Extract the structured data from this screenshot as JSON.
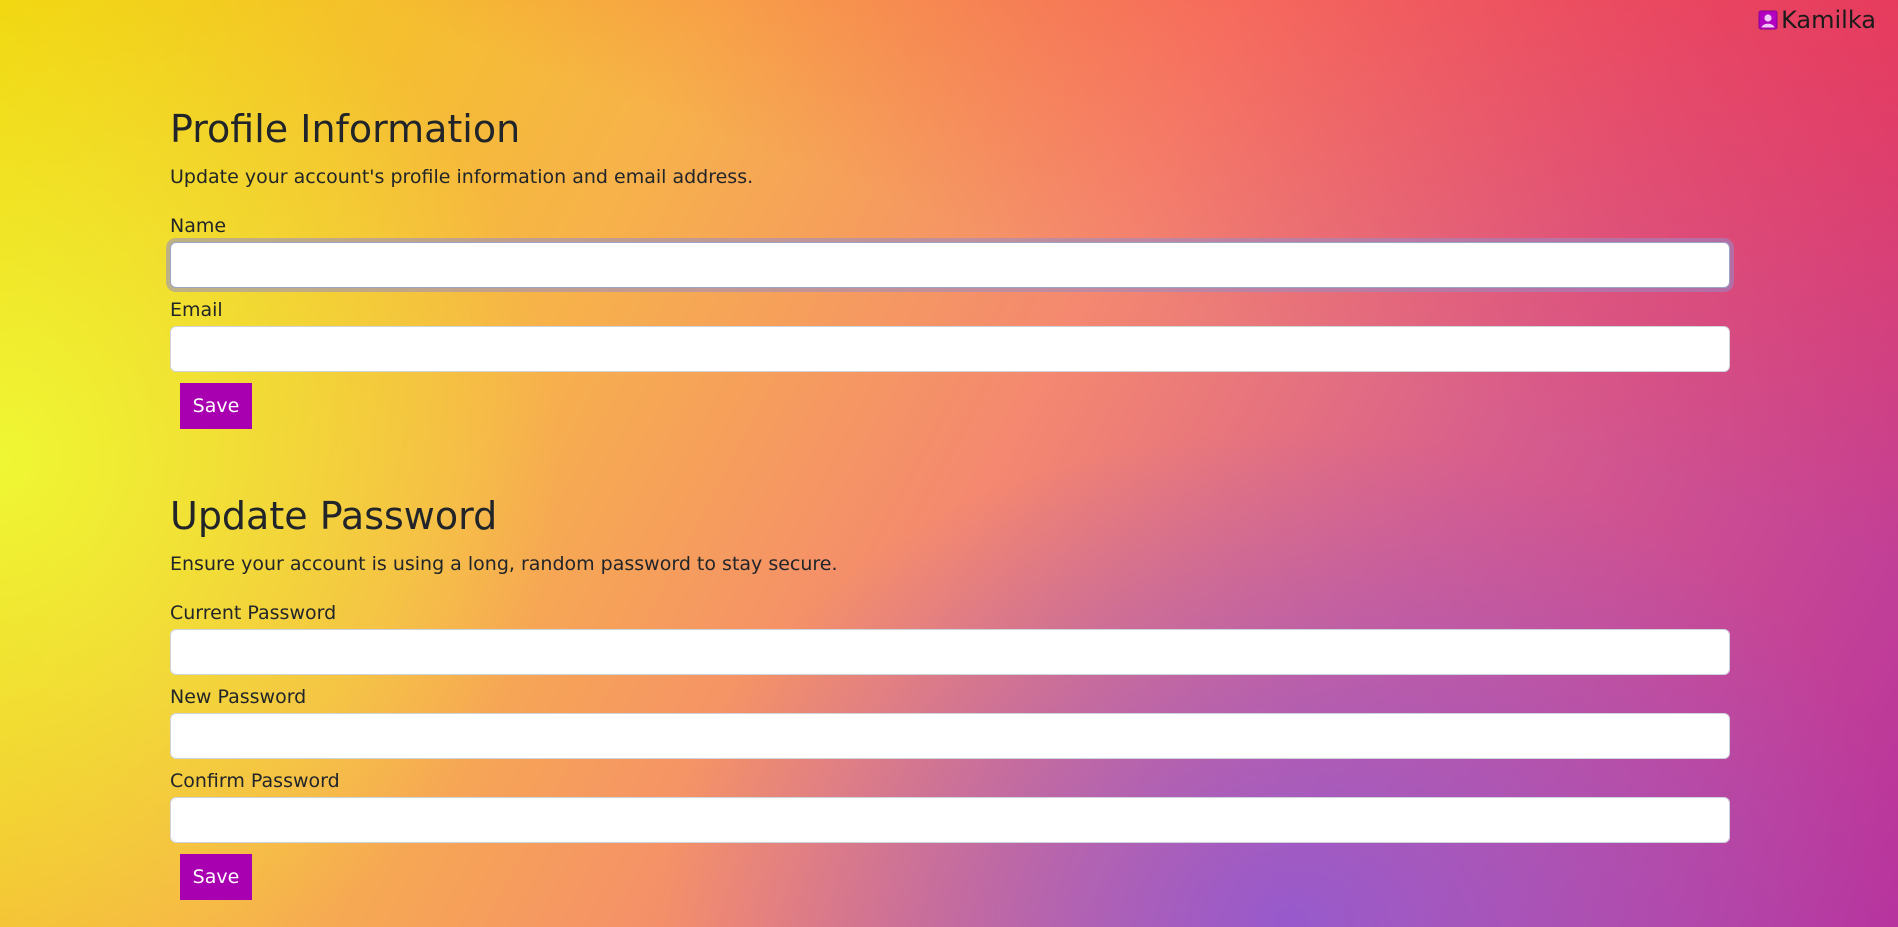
{
  "header": {
    "user_name": "Kamilka",
    "user_icon": "person-square-icon"
  },
  "profile": {
    "title": "Profile Information",
    "description": "Update your account's profile information and email address.",
    "name_label": "Name",
    "name_value": "",
    "email_label": "Email",
    "email_value": "",
    "save_label": "Save"
  },
  "password": {
    "title": "Update Password",
    "description": "Ensure your account is using a long, random password to stay secure.",
    "current_label": "Current Password",
    "new_label": "New Password",
    "confirm_label": "Confirm Password",
    "save_label": "Save"
  },
  "colors": {
    "accent": "#a800b0",
    "gradient": [
      "#f2d10b",
      "#f7b24a",
      "#f48870",
      "#d85e8c",
      "#b8329c",
      "#8c5ad7"
    ]
  }
}
